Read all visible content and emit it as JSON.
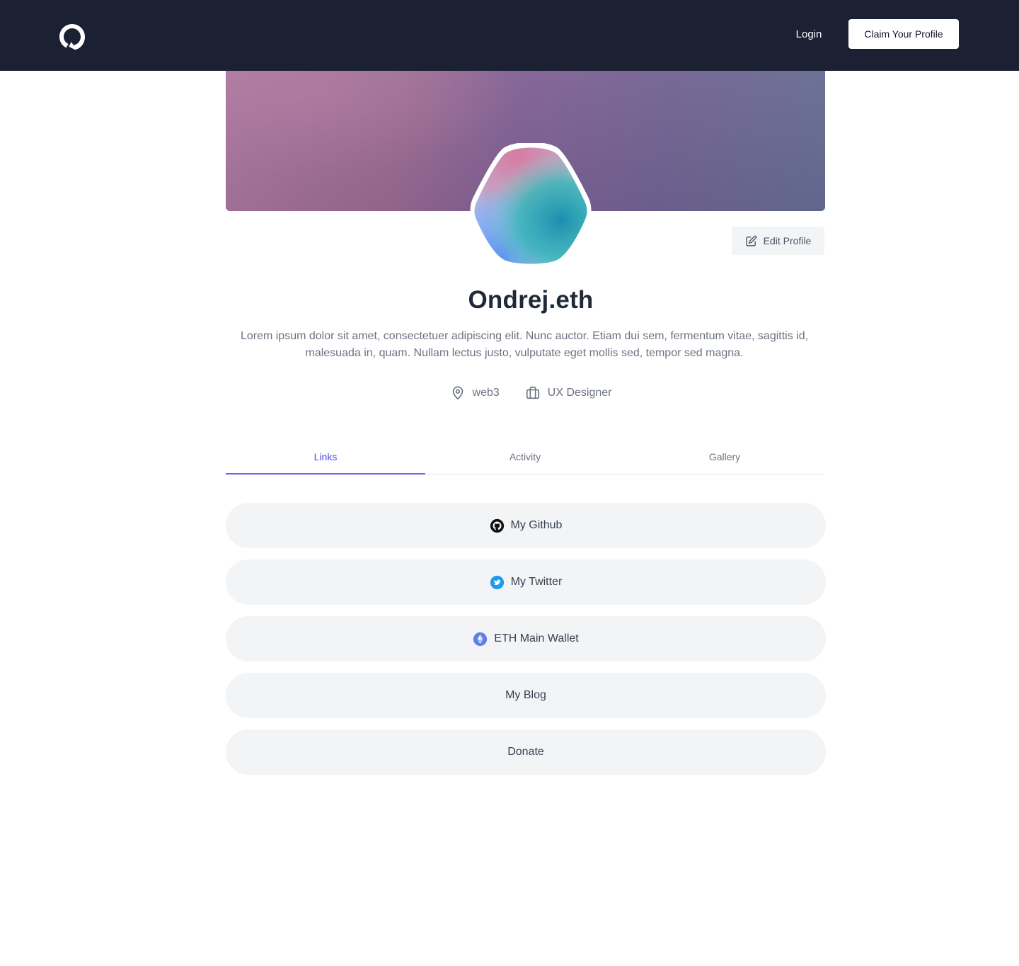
{
  "header": {
    "logo_icon": "brand-logo-icon",
    "login_label": "Login",
    "claim_label": "Claim Your Profile"
  },
  "profile": {
    "name": "Ondrej.eth",
    "bio": "Lorem ipsum dolor sit amet, consectetuer adipiscing elit. Nunc auctor. Etiam dui sem, fermentum vitae, sagittis id, malesuada in, quam. Nullam lectus justo, vulputate eget mollis sed, tempor sed magna.",
    "edit_label": "Edit Profile",
    "location": "web3",
    "role": "UX Designer"
  },
  "tabs": [
    {
      "label": "Links",
      "active": true
    },
    {
      "label": "Activity",
      "active": false
    },
    {
      "label": "Gallery",
      "active": false
    }
  ],
  "links": [
    {
      "label": "My Github",
      "icon": "github-icon"
    },
    {
      "label": "My Twitter",
      "icon": "twitter-icon"
    },
    {
      "label": "ETH Main Wallet",
      "icon": "ethereum-icon"
    },
    {
      "label": "My Blog",
      "icon": ""
    },
    {
      "label": "Donate",
      "icon": ""
    }
  ],
  "colors": {
    "navbar": "#1b2133",
    "accent": "#4f46e5",
    "link_bg": "#f3f4f6",
    "twitter": "#1d9bf0",
    "ethereum": "#627eea"
  }
}
